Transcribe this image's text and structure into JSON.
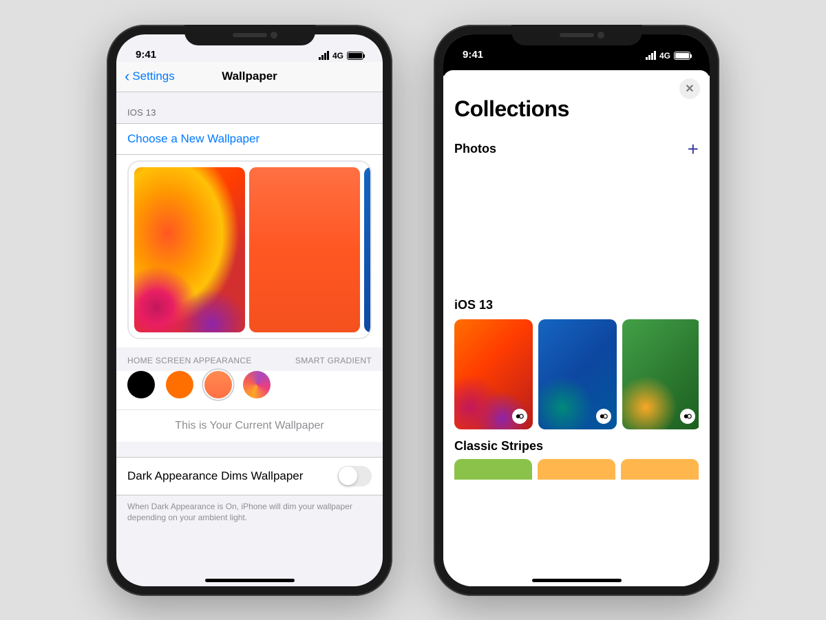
{
  "status": {
    "time": "9:41",
    "network": "4G"
  },
  "left": {
    "nav": {
      "back": "Settings",
      "title": "Wallpaper"
    },
    "section_header": "IOS 13",
    "choose_link": "Choose a New Wallpaper",
    "labels": {
      "home": "HOME SCREEN APPEARANCE",
      "smart": "SMART GRADIENT"
    },
    "current_text": "This is Your Current Wallpaper",
    "dark_row": "Dark Appearance Dims Wallpaper",
    "footer": "When Dark Appearance is On, iPhone will dim your wallpaper depending on your ambient light."
  },
  "right": {
    "title": "Collections",
    "photos_label": "Photos",
    "section1": "iOS 13",
    "section2": "Classic Stripes"
  }
}
